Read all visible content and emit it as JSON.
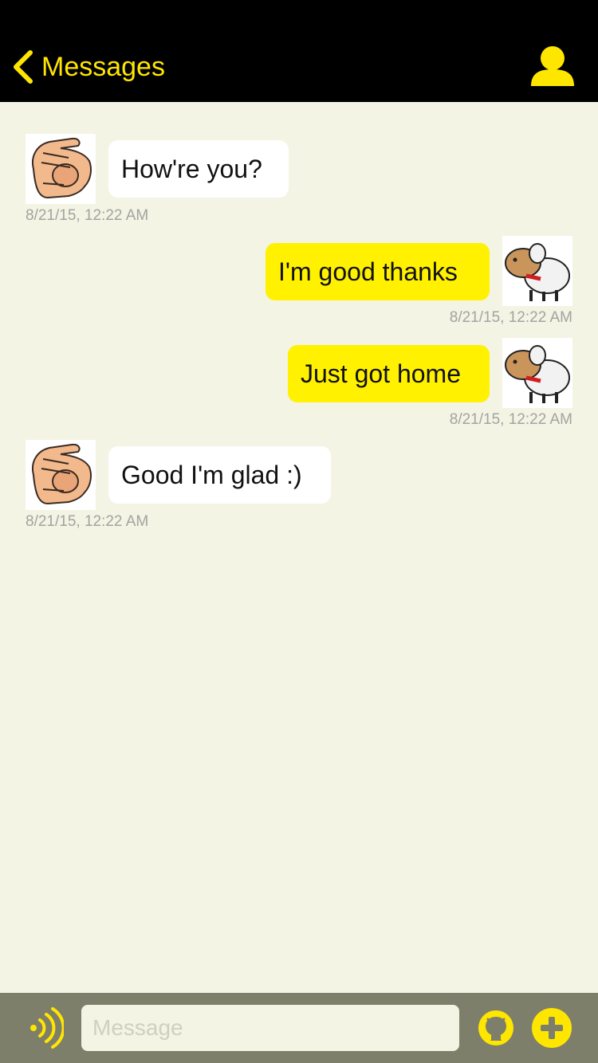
{
  "navbar": {
    "back_label": "Messages",
    "accent_color": "#ffe600",
    "profile_icon": "person-icon"
  },
  "messages": [
    {
      "direction": "incoming",
      "text": "How're you?",
      "timestamp": "8/21/15, 12:22 AM",
      "avatar": "pointing-hand"
    },
    {
      "direction": "outgoing",
      "text": "I'm good thanks",
      "timestamp": "8/21/15, 12:22 AM",
      "avatar": "sheep"
    },
    {
      "direction": "outgoing",
      "text": "Just got home",
      "timestamp": "8/21/15, 12:22 AM",
      "avatar": "sheep"
    },
    {
      "direction": "incoming",
      "text": "Good I'm glad :)",
      "timestamp": "8/21/15, 12:22 AM",
      "avatar": "pointing-hand"
    }
  ],
  "input_bar": {
    "placeholder": "Message",
    "value": "",
    "left_icon": "signal-icon",
    "github_icon": "github-icon",
    "add_icon": "plus-icon"
  }
}
